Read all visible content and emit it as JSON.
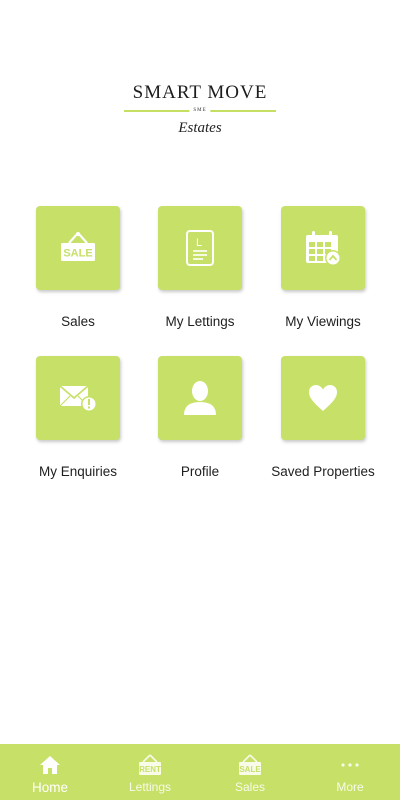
{
  "logo": {
    "title": "SMART MOVE",
    "mark": "SME",
    "subtitle": "Estates"
  },
  "tiles": [
    {
      "label": "Sales",
      "icon": "sale-sign-icon",
      "badge": "SALE"
    },
    {
      "label": "My Lettings",
      "icon": "letting-document-icon",
      "badge": "L"
    },
    {
      "label": "My Viewings",
      "icon": "calendar-icon"
    },
    {
      "label": "My Enquiries",
      "icon": "mail-alert-icon"
    },
    {
      "label": "Profile",
      "icon": "user-icon"
    },
    {
      "label": "Saved Properties",
      "icon": "heart-icon"
    }
  ],
  "nav": [
    {
      "label": "Home",
      "icon": "home-icon",
      "active": true
    },
    {
      "label": "Lettings",
      "icon": "rent-sign-icon",
      "badge": "RENT"
    },
    {
      "label": "Sales",
      "icon": "sale-sign-icon",
      "badge": "SALE"
    },
    {
      "label": "More",
      "icon": "more-dots-icon"
    }
  ],
  "colors": {
    "accent": "#c7e068",
    "icon": "#ffffff",
    "text": "#1e1e1e"
  }
}
